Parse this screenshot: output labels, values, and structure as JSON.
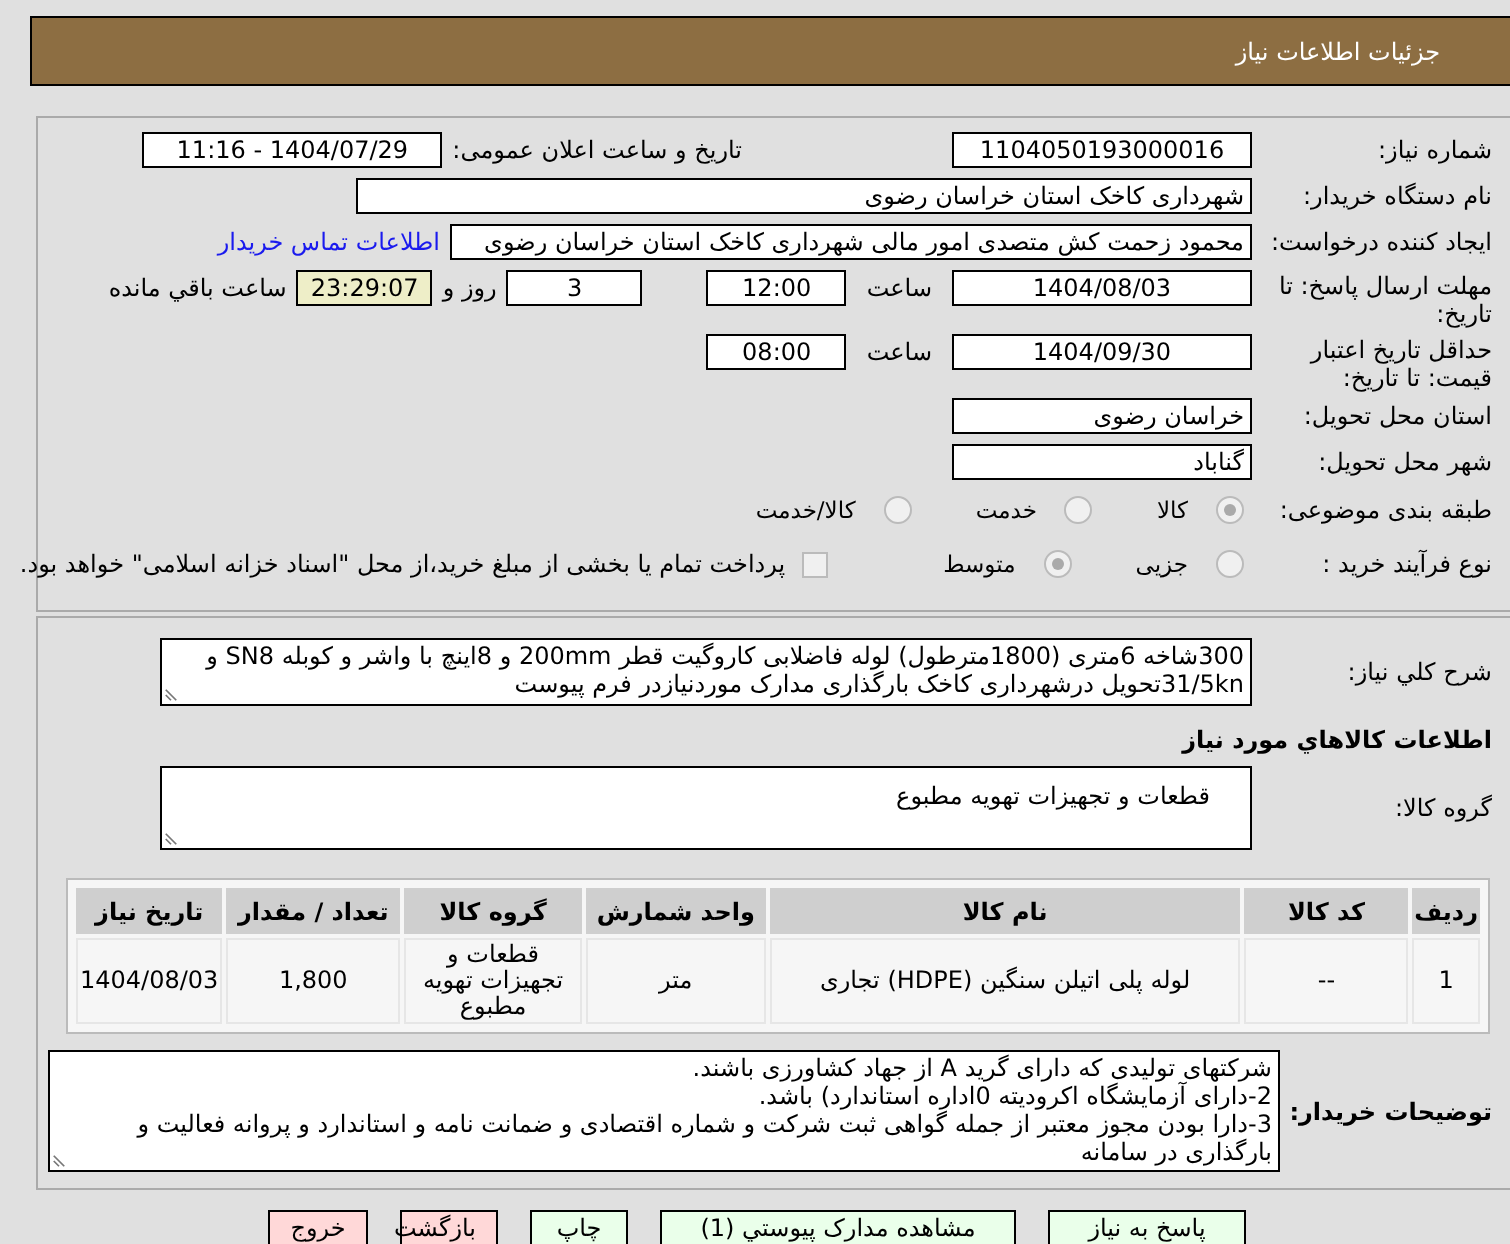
{
  "header": {
    "title": "جزئیات اطلاعات نیاز"
  },
  "need_number": {
    "label": "شماره نیاز:",
    "value": "1104050193000016"
  },
  "announce": {
    "label": "تاریخ و ساعت اعلان عمومی:",
    "value": "1404/07/29 - 11:16"
  },
  "buyer": {
    "label": "نام دستگاه خریدار:",
    "value": "شهرداری کاخک استان خراسان رضوی"
  },
  "requester": {
    "label": "ایجاد کننده درخواست:",
    "value": "محمود زحمت کش متصدی امور مالی شهرداری کاخک استان خراسان رضوی",
    "link": "اطلاعات تماس خریدار"
  },
  "deadline": {
    "label": "مهلت ارسال پاسخ: تا تاریخ:",
    "date": "1404/08/03",
    "time_label": "ساعت",
    "time": "12:00",
    "days": "3",
    "days_label": "روز و",
    "remaining": "23:29:07",
    "remaining_label": "ساعت باقي مانده"
  },
  "validity": {
    "label": "حداقل تاریخ اعتبار قیمت: تا تاریخ:",
    "date": "1404/09/30",
    "time_label": "ساعت",
    "time": "08:00"
  },
  "province": {
    "label": "استان محل تحویل:",
    "value": "خراسان رضوی"
  },
  "city": {
    "label": "شهر محل تحویل:",
    "value": "گناباد"
  },
  "category": {
    "label": "طبقه بندی موضوعی:",
    "options": [
      {
        "label": "کالا",
        "selected": true
      },
      {
        "label": "خدمت",
        "selected": false
      },
      {
        "label": "کالا/خدمت",
        "selected": false
      }
    ]
  },
  "process": {
    "label": "نوع فرآیند خرید :",
    "options": [
      {
        "label": "جزیی",
        "selected": false
      },
      {
        "label": "متوسط",
        "selected": true
      }
    ],
    "payment": {
      "checked": false,
      "text": "پرداخت تمام یا بخشی از مبلغ خرید،از محل \"اسناد خزانه اسلامی\" خواهد بود."
    }
  },
  "description": {
    "label": "شرح کلي نیاز:",
    "value": "300شاخه 6متری (1800مترطول) لوله فاضلابی کاروگیت قطر 200mm و 8اینچ با واشر و کوبله SN8 و 31/5knتحویل درشهرداری کاخک بارگذاری مدارک موردنیازدر فرم پیوست"
  },
  "items_heading": "اطلاعات کالاهاي مورد نیاز",
  "goods_group": {
    "label": "گروه کالا:",
    "value": "قطعات و تجهیزات تهویه مطبوع"
  },
  "table": {
    "columns": [
      "ردیف",
      "کد کالا",
      "نام کالا",
      "واحد شمارش",
      "گروه کالا",
      "تعداد / مقدار",
      "تاریخ نیاز"
    ],
    "rows": [
      [
        "1",
        "--",
        "لوله پلی اتیلن سنگین (HDPE) تجاری",
        "متر",
        "قطعات و تجهیزات تهویه مطبوع",
        "1,800",
        "1404/08/03"
      ]
    ]
  },
  "buyer_notes": {
    "label": "توضیحات خریدار:",
    "value": "شرکتهای تولیدی که دارای گرید A از جهاد کشاورزی باشند.\n2-دارای آزمایشگاه اکرودیته 0اداره استاندارد) باشد.\n3-دارا بودن مجوز معتبر از جمله گواهی ثبت شرکت و شماره اقتصادی و ضمانت نامه و استاندارد و پروانه فعالیت و بارگذاری در سامانه"
  },
  "buttons": [
    {
      "label": "پاسخ به نیاز",
      "kind": "primary"
    },
    {
      "label": "مشاهده مدارک پیوستي (1)",
      "kind": "primary"
    },
    {
      "label": "چاپ",
      "kind": "primary"
    },
    {
      "label": "بازگشت",
      "kind": "danger"
    },
    {
      "label": "خروج",
      "kind": "danger"
    }
  ]
}
